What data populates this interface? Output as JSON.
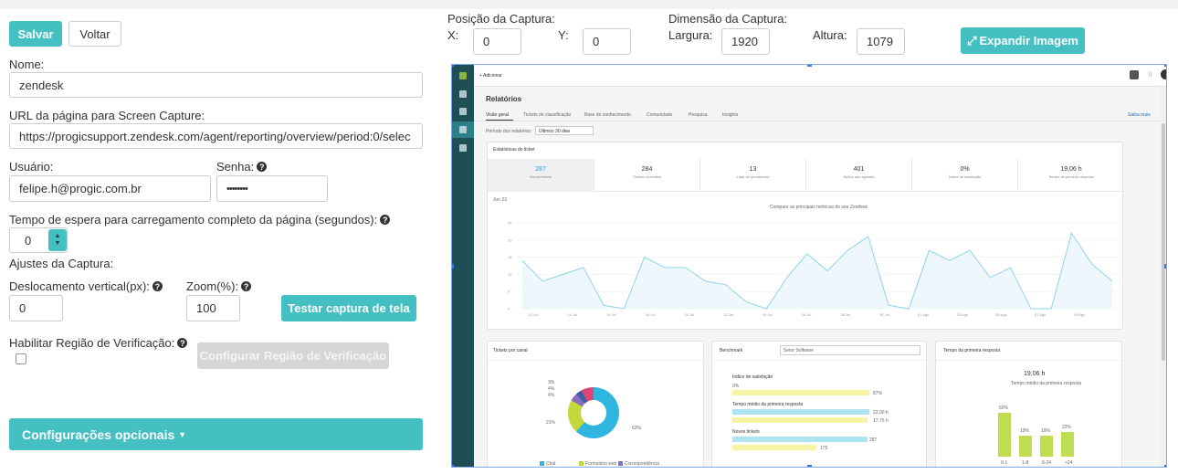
{
  "toolbar": {
    "save_label": "Salvar",
    "back_label": "Voltar"
  },
  "form": {
    "name_label": "Nome:",
    "name_value": "zendesk",
    "url_label": "URL da página para Screen Capture:",
    "url_value": "https://progicsupport.zendesk.com/agent/reporting/overview/period:0/selec",
    "user_label": "Usuário:",
    "user_value": "felipe.h@progic.com.br",
    "password_label": "Senha:",
    "password_value": "••••••••",
    "wait_label": "Tempo de espera para carregamento completo da página (segundos):",
    "wait_value": "0",
    "adjust_label": "Ajustes da Captura:",
    "vscroll_label": "Deslocamento vertical(px):",
    "vscroll_value": "0",
    "zoom_label": "Zoom(%):",
    "zoom_value": "100",
    "test_button": "Testar captura de tela",
    "verify_label": "Habilitar Região de Verificação:",
    "verify_button": "Configurar Região de Verificação",
    "optional_label": "Configurações opcionais"
  },
  "capture": {
    "position_label": "Posição da Captura:",
    "x_label": "X:",
    "x_value": "0",
    "y_label": "Y:",
    "y_value": "0",
    "dimension_label": "Dimensão da Captura:",
    "width_label": "Largura:",
    "width_value": "1920",
    "height_label": "Altura:",
    "height_value": "1079",
    "expand_button": "Expandir Imagem"
  },
  "preview": {
    "add_label": "+ Adicionar",
    "title": "Relatórios",
    "tabs": [
      "Visão geral",
      "Tickets de classificação",
      "Base de conhecimento",
      "Comunidade",
      "Pesquisa",
      "Insights"
    ],
    "more_label": "Saiba mais",
    "period_label": "Período dos relatórios:",
    "period_value": "Últimos 30 dias",
    "stats_title": "Estatísticas do ticket",
    "stats": [
      {
        "value": "287",
        "name": "Novos tickets"
      },
      {
        "value": "284",
        "name": "Tickets resolvidos"
      },
      {
        "value": "13",
        "name": "Lidar de pendências"
      },
      {
        "value": "401",
        "name": "Ações dos agentes"
      },
      {
        "value": "0%",
        "name": "Índice de satisfação"
      },
      {
        "value": "19,06 h",
        "name": "Tempo da primeira resposta"
      }
    ],
    "chart_caption": "Compare as principais métricas do seu Zendesk",
    "chart_corner": "Jun 23",
    "chart_yticks": [
      "25",
      "20",
      "15",
      "10",
      "5",
      "0"
    ],
    "chart_xticks": [
      "12 Jul",
      "14 Jul",
      "16 Jul",
      "18 Jul",
      "20 Jul",
      "22 Jul",
      "24 Jul",
      "26 Jul",
      "28 Jul",
      "30 Jul",
      "01 Ago",
      "03 Ago",
      "05 Ago",
      "07 Ago",
      "09 Ago"
    ],
    "panel1_title": "Tickets por canal",
    "panel1_pcts": [
      "3%",
      "4%",
      "4%",
      "21%",
      "62%"
    ],
    "panel1_legend": [
      "Chat",
      "Formulário web",
      "Correspondência"
    ],
    "panel2_title": "Benchmark",
    "panel2_select": "Setor Software",
    "panel2_rows": [
      {
        "label": "Índice de satisfação",
        "v1": "0%",
        "v2": "87%"
      },
      {
        "label": "Tempo médio da primeira resposta",
        "v1": "23,00 h",
        "v2": "17,75 h"
      },
      {
        "label": "Novos tickets",
        "v1": "287",
        "v2": "175"
      }
    ],
    "panel3_title": "Tempo da primeira resposta",
    "panel3_value": "19,06 h",
    "panel3_caption": "Tempo médio da primeira resposta",
    "panel3_pcts": [
      "60%",
      "19%",
      "19%",
      "22%"
    ],
    "panel3_cats": [
      "0-1",
      "1-8",
      "8-24",
      ">24"
    ]
  },
  "colors": {
    "accent": "#44bfc2",
    "sidebar": "#1f4e55",
    "line": "#8fd3e8"
  }
}
